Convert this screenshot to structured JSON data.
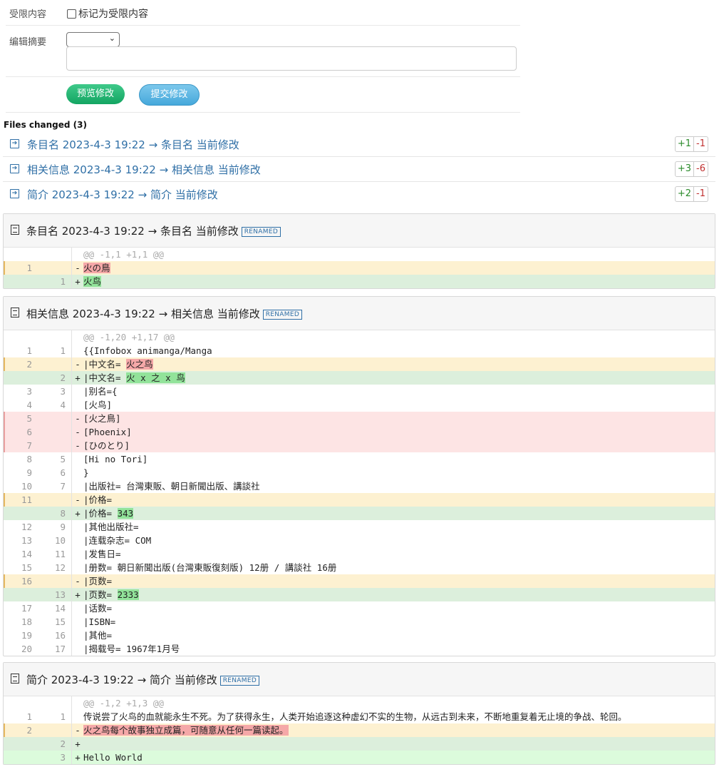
{
  "form": {
    "restricted_label": "受限内容",
    "restricted_checkbox_label": "标记为受限内容",
    "summary_label": "编辑摘要",
    "summary_select_value": "",
    "summary_input_value": "",
    "preview_button": "预览修改",
    "submit_button": "提交修改"
  },
  "files_changed": {
    "title": "Files changed (3)",
    "items": [
      {
        "label": "条目名 2023-4-3 19:22 → 条目名 当前修改",
        "add": "+1",
        "del": "-1"
      },
      {
        "label": "相关信息 2023-4-3 19:22 → 相关信息 当前修改",
        "add": "+3",
        "del": "-6"
      },
      {
        "label": "简介 2023-4-3 19:22 → 简介 当前修改",
        "add": "+2",
        "del": "-1"
      }
    ]
  },
  "diffs": [
    {
      "title": "条目名 2023-4-3 19:22 → 条目名 当前修改",
      "badge": "RENAMED",
      "lines": [
        {
          "type": "hunk",
          "old": "",
          "new": "",
          "sign": "",
          "text": "@@ -1,1 +1,1 @@"
        },
        {
          "type": "chg",
          "old": "1",
          "new": "",
          "sign": "-",
          "pre": "",
          "hl": "火の鳥",
          "hlType": "del"
        },
        {
          "type": "add",
          "old": "",
          "new": "1",
          "sign": "+",
          "pre": "",
          "hl": "火鸟",
          "hlType": "add"
        }
      ]
    },
    {
      "title": "相关信息 2023-4-3 19:22 → 相关信息 当前修改",
      "badge": "RENAMED",
      "lines": [
        {
          "type": "hunk",
          "old": "",
          "new": "",
          "sign": "",
          "text": "@@ -1,20 +1,17 @@"
        },
        {
          "type": "ctx",
          "old": "1",
          "new": "1",
          "sign": "",
          "text": "{{Infobox animanga/Manga"
        },
        {
          "type": "chg",
          "old": "2",
          "new": "",
          "sign": "-",
          "pre": "|中文名= ",
          "hl": "火之鸟",
          "hlType": "del"
        },
        {
          "type": "add",
          "old": "",
          "new": "2",
          "sign": "+",
          "pre": "|中文名= ",
          "hl": "火 x 之 x 鸟",
          "hlType": "add"
        },
        {
          "type": "ctx",
          "old": "3",
          "new": "3",
          "sign": "",
          "text": "|别名={"
        },
        {
          "type": "ctx",
          "old": "4",
          "new": "4",
          "sign": "",
          "text": "[火鸟]"
        },
        {
          "type": "del",
          "old": "5",
          "new": "",
          "sign": "-",
          "text": "[火之鳥]"
        },
        {
          "type": "del",
          "old": "6",
          "new": "",
          "sign": "-",
          "text": "[Phoenix]"
        },
        {
          "type": "del",
          "old": "7",
          "new": "",
          "sign": "-",
          "text": "[ひのとり]"
        },
        {
          "type": "ctx",
          "old": "8",
          "new": "5",
          "sign": "",
          "text": "[Hi no Tori]"
        },
        {
          "type": "ctx",
          "old": "9",
          "new": "6",
          "sign": "",
          "text": "}"
        },
        {
          "type": "ctx",
          "old": "10",
          "new": "7",
          "sign": "",
          "text": "|出版社= 台灣東販、朝日新聞出版、講談社"
        },
        {
          "type": "chg",
          "old": "11",
          "new": "",
          "sign": "-",
          "pre": "|价格=",
          "hl": "",
          "hlType": "del"
        },
        {
          "type": "add",
          "old": "",
          "new": "8",
          "sign": "+",
          "pre": "|价格= ",
          "hl": "343",
          "hlType": "add"
        },
        {
          "type": "ctx",
          "old": "12",
          "new": "9",
          "sign": "",
          "text": "|其他出版社="
        },
        {
          "type": "ctx",
          "old": "13",
          "new": "10",
          "sign": "",
          "text": "|连载杂志= COM"
        },
        {
          "type": "ctx",
          "old": "14",
          "new": "11",
          "sign": "",
          "text": "|发售日="
        },
        {
          "type": "ctx",
          "old": "15",
          "new": "12",
          "sign": "",
          "text": "|册数= 朝日新聞出版(台灣東販復刻版) 12册 / 講談社 16册"
        },
        {
          "type": "chg",
          "old": "16",
          "new": "",
          "sign": "-",
          "pre": "|页数=",
          "hl": "",
          "hlType": "del"
        },
        {
          "type": "add",
          "old": "",
          "new": "13",
          "sign": "+",
          "pre": "|页数= ",
          "hl": "2333",
          "hlType": "add"
        },
        {
          "type": "ctx",
          "old": "17",
          "new": "14",
          "sign": "",
          "text": "|话数="
        },
        {
          "type": "ctx",
          "old": "18",
          "new": "15",
          "sign": "",
          "text": "|ISBN="
        },
        {
          "type": "ctx",
          "old": "19",
          "new": "16",
          "sign": "",
          "text": "|其他="
        },
        {
          "type": "ctx",
          "old": "20",
          "new": "17",
          "sign": "",
          "text": "|揭载号= 1967年1月号"
        }
      ]
    },
    {
      "title": "简介 2023-4-3 19:22 → 简介 当前修改",
      "badge": "RENAMED",
      "lines": [
        {
          "type": "hunk",
          "old": "",
          "new": "",
          "sign": "",
          "text": "@@ -1,2 +1,3 @@"
        },
        {
          "type": "ctx",
          "old": "1",
          "new": "1",
          "sign": "",
          "text": "传说尝了火鸟的血就能永生不死。为了获得永生，人类开始追逐这种虚幻不实的生物，从远古到未来，不断地重复着无止境的争战、轮回。"
        },
        {
          "type": "chg",
          "old": "2",
          "new": "",
          "sign": "-",
          "pre": "",
          "hl": "火之鸟每个故事独立成篇，可随意从任何一篇读起。",
          "hlType": "del"
        },
        {
          "type": "add",
          "old": "",
          "new": "2",
          "sign": "+",
          "text": ""
        },
        {
          "type": "add2",
          "old": "",
          "new": "3",
          "sign": "+",
          "text": "Hello World"
        }
      ]
    }
  ]
}
